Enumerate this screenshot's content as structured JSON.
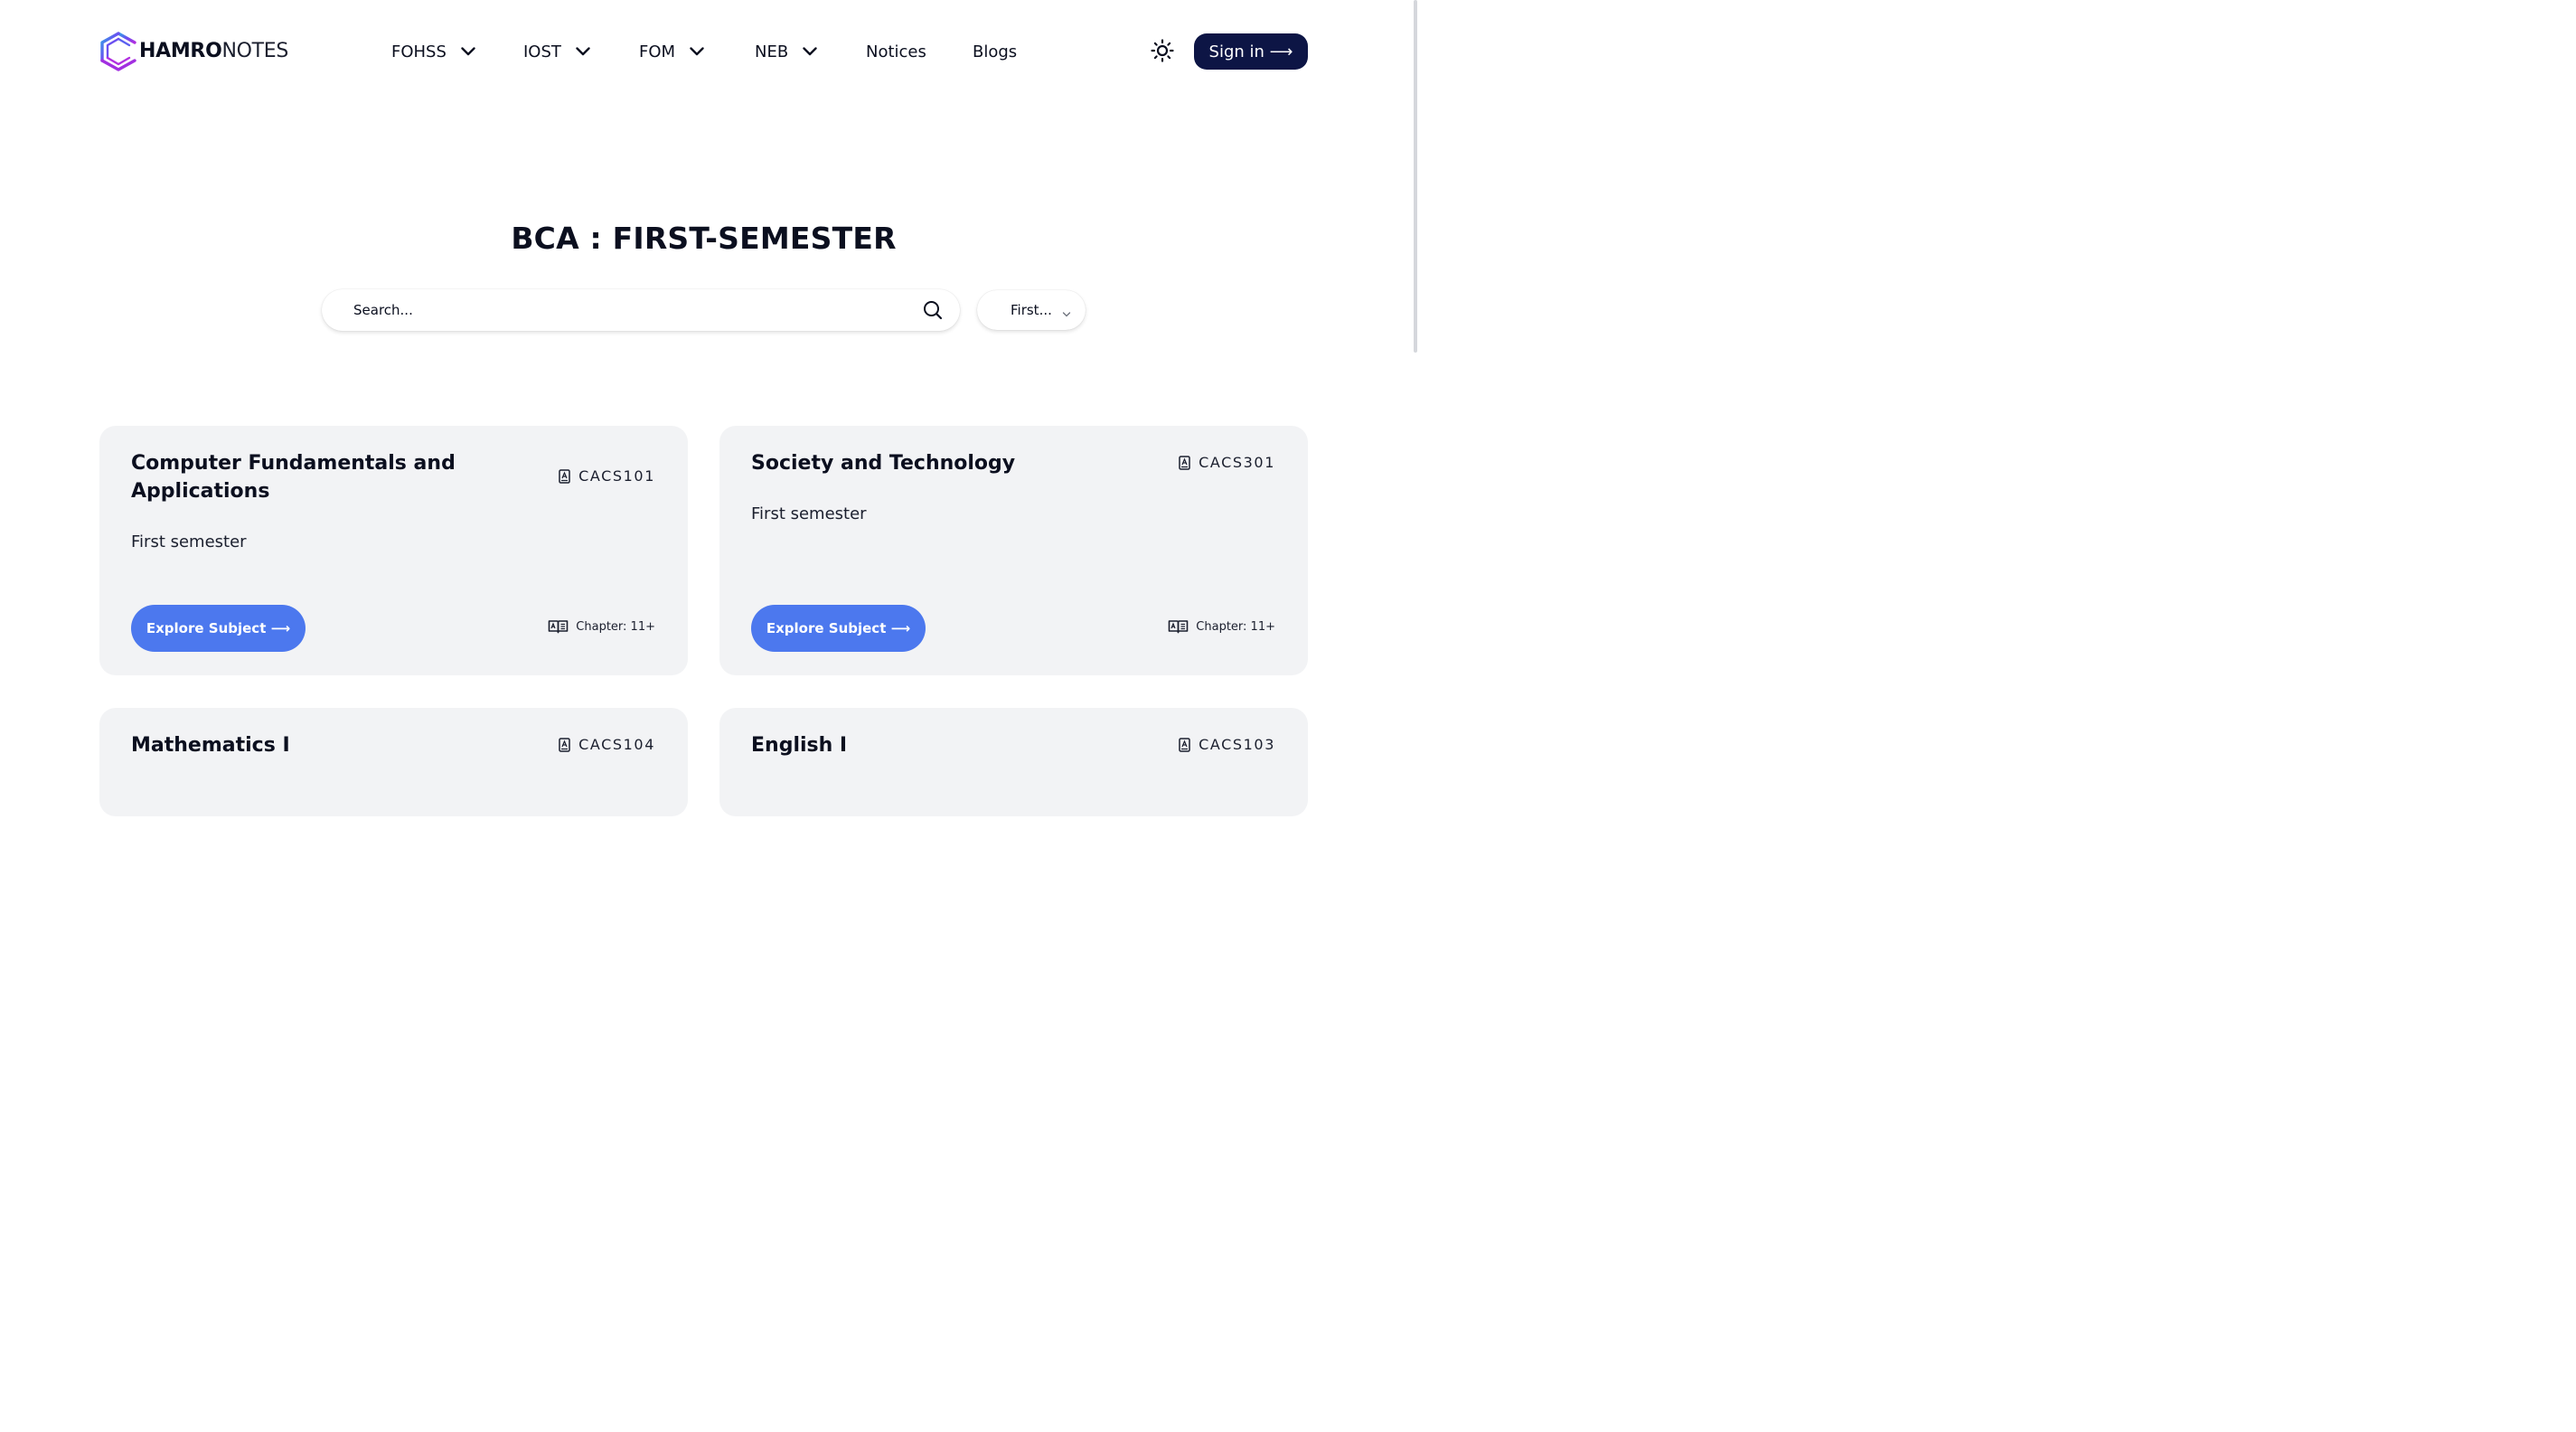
{
  "brand": {
    "bold": "HAMRO",
    "light": "NOTES",
    "logo_icon": "hexagon-logo-icon"
  },
  "nav": {
    "items": [
      {
        "label": "FOHSS",
        "has_dropdown": true
      },
      {
        "label": "IOST",
        "has_dropdown": true
      },
      {
        "label": "FOM",
        "has_dropdown": true
      },
      {
        "label": "NEB",
        "has_dropdown": true
      },
      {
        "label": "Notices",
        "has_dropdown": false
      },
      {
        "label": "Blogs",
        "has_dropdown": false
      }
    ],
    "theme_icon": "sun-icon",
    "signin_label": "Sign in ⟶"
  },
  "page": {
    "title": "BCA : FIRST-SEMESTER"
  },
  "search": {
    "placeholder": "Search...",
    "icon": "search-icon"
  },
  "semester_select": {
    "value": "First..."
  },
  "cards": [
    {
      "title": "Computer Fundamentals and Applications",
      "code": "CACS101",
      "subtitle": "First semester",
      "button": "Explore Subject ⟶",
      "chapters": "Chapter: 11+"
    },
    {
      "title": "Society and Technology",
      "code": "CACS301",
      "subtitle": "First semester",
      "button": "Explore Subject ⟶",
      "chapters": "Chapter: 11+"
    },
    {
      "title": "Mathematics I",
      "code": "CACS104"
    },
    {
      "title": "English I",
      "code": "CACS103"
    }
  ],
  "colors": {
    "primary_dark": "#0d1545",
    "accent_blue": "#4c78ee",
    "card_bg": "#f2f3f5"
  }
}
